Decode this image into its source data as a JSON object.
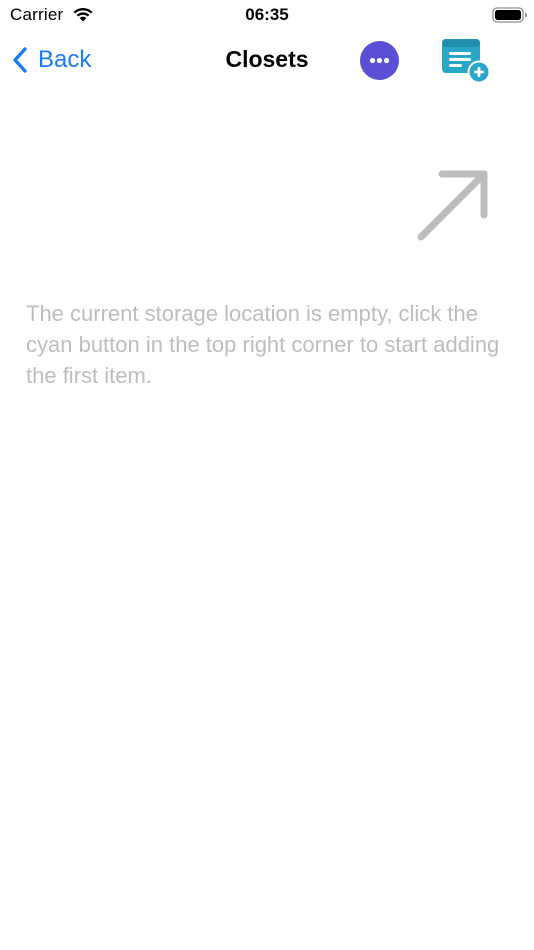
{
  "status_bar": {
    "carrier": "Carrier",
    "time": "06:35",
    "icons": [
      "wifi-icon",
      "battery-icon"
    ]
  },
  "nav": {
    "back_label": "Back",
    "title": "Closets",
    "back_icon": "chevron-left-icon",
    "more_icon": "ellipsis-icon",
    "add_icon": "add-list-icon"
  },
  "empty_state": {
    "message": "The current storage location is empty, click the cyan button in the top right corner to start adding the first item.",
    "icon": "arrow-up-right-icon"
  },
  "colors": {
    "accent_blue": "#1a7cf5",
    "more_button_purple": "#5b4fd6",
    "add_button_cyan": "#2aa7c6",
    "hint_gray": "#bdbdbd"
  }
}
